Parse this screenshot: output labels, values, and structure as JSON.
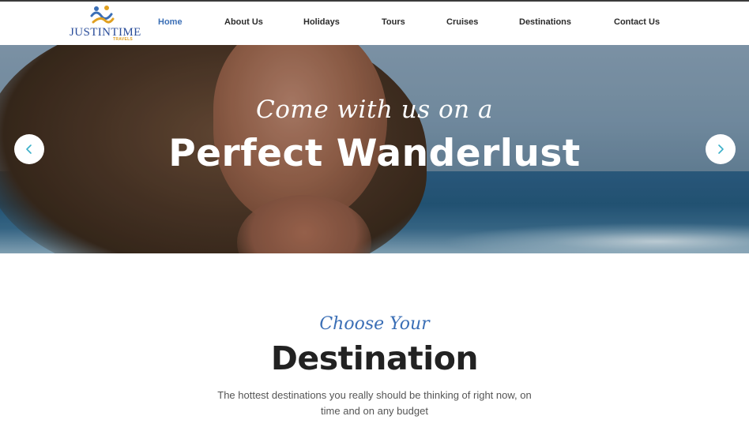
{
  "brand": {
    "name": "JUSTINTIME",
    "sub": "TRAVELS",
    "colors": {
      "primary": "#3b6fb6",
      "accent": "#e0a020"
    }
  },
  "nav": {
    "items": [
      {
        "label": "Home",
        "active": true
      },
      {
        "label": "About Us",
        "active": false
      },
      {
        "label": "Holidays",
        "active": false
      },
      {
        "label": "Tours",
        "active": false
      },
      {
        "label": "Cruises",
        "active": false
      },
      {
        "label": "Destinations",
        "active": false
      },
      {
        "label": "Contact Us",
        "active": false
      }
    ]
  },
  "hero": {
    "script": "Come with us on a",
    "title": "Perfect Wanderlust",
    "prev_icon": "chevron-left-icon",
    "next_icon": "chevron-right-icon"
  },
  "destination": {
    "script": "Choose Your",
    "title": "Destination",
    "text": "The hottest destinations you really should be thinking of right now, on time and on any budget"
  }
}
